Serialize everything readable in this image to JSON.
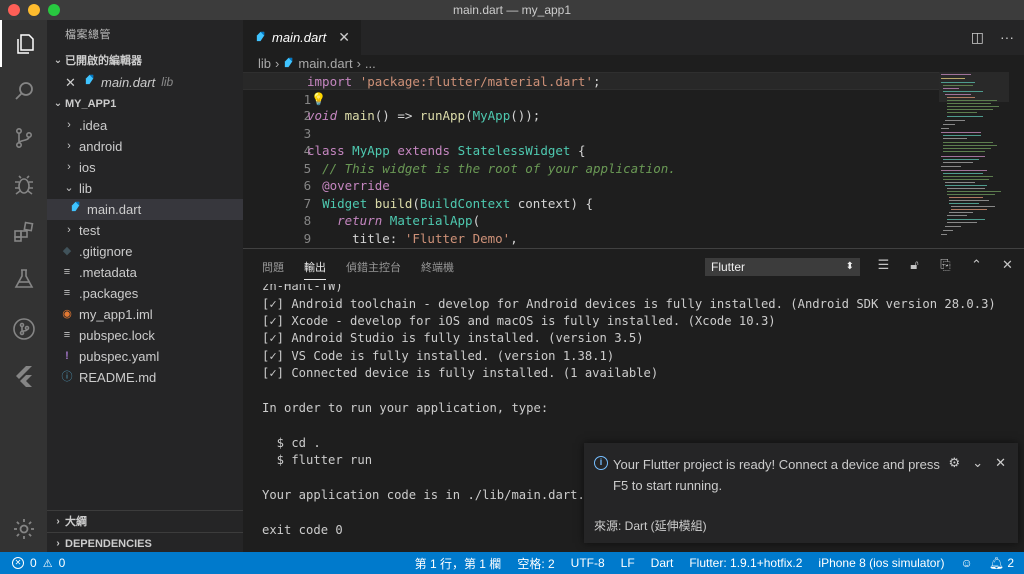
{
  "window": {
    "title": "main.dart — my_app1"
  },
  "colors": {
    "accent": "#007acc",
    "editor_bg": "#1e1e1e",
    "sidebar_bg": "#252526",
    "activity_bg": "#333333"
  },
  "activity_bar": {
    "items": [
      "files-icon",
      "search-icon",
      "source-control-icon",
      "debug-icon",
      "extensions-icon",
      "flask-icon",
      "git-graph-icon",
      "flutter-icon"
    ],
    "bottom": "gear-icon"
  },
  "sidebar": {
    "title": "檔案總管",
    "open_editors": {
      "label": "已開啟的編輯器",
      "items": [
        {
          "name": "main.dart",
          "folder": "lib"
        }
      ]
    },
    "project": {
      "label": "MY_APP1",
      "items": [
        {
          "name": ".idea",
          "type": "folder"
        },
        {
          "name": "android",
          "type": "folder"
        },
        {
          "name": "ios",
          "type": "folder"
        },
        {
          "name": "lib",
          "type": "folder-open"
        },
        {
          "name": "main.dart",
          "type": "dart"
        },
        {
          "name": "test",
          "type": "folder"
        },
        {
          "name": ".gitignore",
          "type": "git"
        },
        {
          "name": ".metadata",
          "type": "text"
        },
        {
          "name": ".packages",
          "type": "text"
        },
        {
          "name": "my_app1.iml",
          "type": "rss"
        },
        {
          "name": "pubspec.lock",
          "type": "text"
        },
        {
          "name": "pubspec.yaml",
          "type": "yaml"
        },
        {
          "name": "README.md",
          "type": "info"
        }
      ]
    },
    "outline_label": "大綱",
    "dependencies_label": "DEPENDENCIES"
  },
  "editor": {
    "tab": {
      "label": "main.dart",
      "close": "✕"
    },
    "breadcrumb": [
      "lib",
      "main.dart",
      "..."
    ],
    "line_numbers": [
      "1",
      "2",
      "3",
      "4",
      "5",
      "6",
      "7",
      "8",
      "9",
      "10"
    ],
    "code": {
      "l1_kw": "import",
      "l1_str": "'package:flutter/material.dart'",
      "l1_end": ";",
      "l3_kw": "void",
      "l3_fn": "main",
      "l3_mid": "() => ",
      "l3_fn2": "runApp",
      "l3_p": "(",
      "l3_cls": "MyApp",
      "l3_end": "());",
      "l5_kw": "class",
      "l5_cls": "MyApp",
      "l5_kw2": "extends",
      "l5_cls2": "StatelessWidget",
      "l5_end": " {",
      "l6_cm": "// This widget is the root of your application.",
      "l7_dec": "@override",
      "l8_cls": "Widget",
      "l8_fn": "build",
      "l8_p": "(",
      "l8_cls2": "BuildContext",
      "l8_end": " context) {",
      "l9_kw": "return",
      "l9_cls": "MaterialApp",
      "l9_end": "(",
      "l10_key": "title: ",
      "l10_str": "'Flutter Demo'",
      "l10_end": ","
    }
  },
  "panel": {
    "tabs": [
      "問題",
      "輸出",
      "偵錯主控台",
      "終端機"
    ],
    "active_tab": "輸出",
    "output_channel": "Flutter",
    "output_lines": [
      "zh-Hant-TW)",
      "[✓] Android toolchain - develop for Android devices is fully installed. (Android SDK version 28.0.3)",
      "[✓] Xcode - develop for iOS and macOS is fully installed. (Xcode 10.3)",
      "[✓] Android Studio is fully installed. (version 3.5)",
      "[✓] VS Code is fully installed. (version 1.38.1)",
      "[✓] Connected device is fully installed. (1 available)",
      "",
      "In order to run your application, type:",
      "",
      "  $ cd .",
      "  $ flutter run",
      "",
      "Your application code is in ./lib/main.dart.",
      "",
      "exit code 0"
    ]
  },
  "notification": {
    "message": "Your Flutter project is ready! Connect a device and press F5 to start running.",
    "source": "來源: Dart (延伸模組)"
  },
  "statusbar": {
    "errors": "0",
    "warnings": "0",
    "position": "第 1 行，第 1 欄",
    "spaces": "空格: 2",
    "encoding": "UTF-8",
    "eol": "LF",
    "language": "Dart",
    "flutter": "Flutter: 1.9.1+hotfix.2",
    "device": "iPhone 8 (ios simulator)",
    "notifications": "2"
  }
}
